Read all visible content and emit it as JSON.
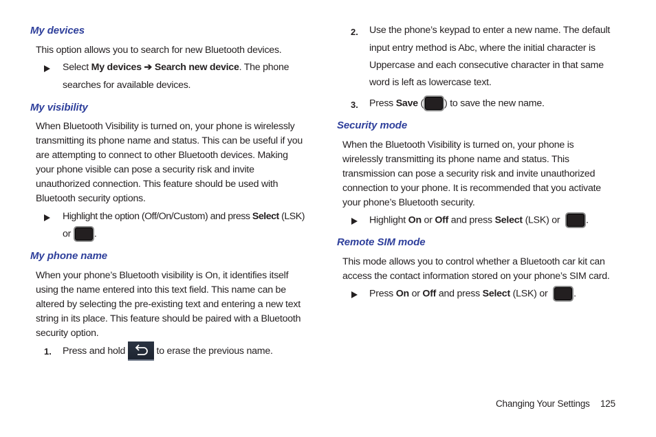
{
  "left": {
    "my_devices": {
      "heading": "My devices",
      "intro": "This option allows you to search for new Bluetooth devices.",
      "bullet": {
        "prefix": "Select ",
        "bold1": "My devices",
        "arrow": " ➔ ",
        "bold2": "Search new device",
        "suffix": ". The phone",
        "line2": "searches for available devices."
      }
    },
    "my_visibility": {
      "heading": "My visibility",
      "lines": [
        "When Bluetooth Visibility is turned on, your phone is wirelessly",
        "transmitting its phone name and status. This can be useful if you",
        "are attempting to connect to other Bluetooth devices. Making",
        "your phone visible can pose a security risk and invite",
        "unauthorized connection. This feature should be used with",
        "Bluetooth security options."
      ],
      "bullet": {
        "prefix": "Highlight the option (Off/On/Custom) and press ",
        "bold": "Select",
        "suffix": " (LSK)",
        "line2_prefix": "or ",
        "line2_suffix": "."
      }
    },
    "my_phone_name": {
      "heading": "My phone name",
      "lines": [
        "When your phone’s Bluetooth visibility is On, it identifies itself",
        "using the name entered into this text field. This name can be",
        "altered by selecting the pre-existing text and entering a new text",
        "string in its place. This feature should be paired with a Bluetooth",
        "security option."
      ],
      "step1": {
        "number": "1.",
        "prefix": "Press and hold ",
        "icon": "back-key-icon",
        "suffix": " to erase the previous name."
      }
    }
  },
  "right": {
    "step2": {
      "number": "2.",
      "lines": [
        "Use the phone’s keypad to enter a new name. The default",
        "input entry method is Abc, where the initial character is",
        "Uppercase and each consecutive character in that same",
        "word is left as lowercase text."
      ]
    },
    "step3": {
      "number": "3.",
      "prefix": "Press ",
      "bold": "Save",
      "open": " (",
      "close": ") to save the new name."
    },
    "security_mode": {
      "heading": "Security mode",
      "lines": [
        "When the Bluetooth Visibility is turned on, your phone is",
        "wirelessly transmitting its phone name and status. This",
        "transmission can pose a security risk and invite unauthorized",
        "connection to your phone. It is recommended that you activate",
        "your phone’s Bluetooth security."
      ],
      "bullet": {
        "prefix": "Highlight ",
        "bold1": "On",
        "mid1": " or ",
        "bold2": "Off",
        "mid2": " and press ",
        "bold3": "Select",
        "suffix": " (LSK) or ",
        "end": "."
      }
    },
    "remote_sim_mode": {
      "heading": "Remote SIM mode",
      "lines": [
        "This mode allows you to control whether a Bluetooth car kit can",
        "access the contact information stored on your phone’s SIM card."
      ],
      "bullet": {
        "prefix": "Press ",
        "bold1": "On",
        "mid1": " or ",
        "bold2": "Off",
        "mid2": " and press ",
        "bold3": "Select",
        "suffix": " (LSK) or ",
        "end": "."
      }
    }
  },
  "footer": {
    "section": "Changing Your Settings",
    "page": "125"
  },
  "colors": {
    "heading": "#2e3f9b",
    "text": "#231f20"
  }
}
